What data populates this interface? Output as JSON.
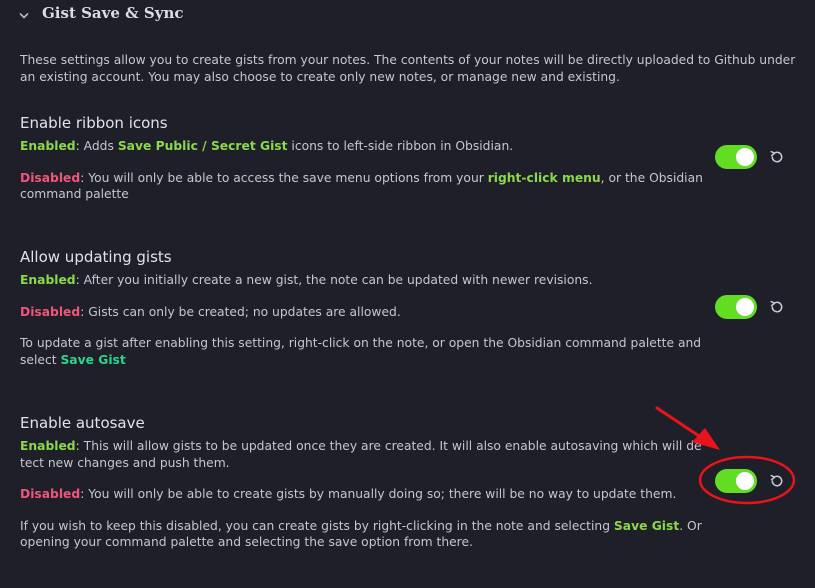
{
  "section": {
    "title": "Gist Save & Sync",
    "intro": "These settings allow you to create gists from your notes. The contents of your notes will be directly uploaded to Github under an existing account. You may also choose to create only new notes, or manage new and existing."
  },
  "settings": [
    {
      "name": "Enable ribbon icons",
      "enabled_label": "Enabled",
      "enabled_a": ": Adds ",
      "enabled_hl": "Save Public / Secret Gist",
      "enabled_b": " icons to left-side ribbon in Obsidian.",
      "disabled_label": "Disabled",
      "disabled_a": ": You will only be able to access the save menu options from your ",
      "disabled_hl": "right-click menu",
      "disabled_b": ", or the Obsidian command palette",
      "toggle_on": true
    },
    {
      "name": "Allow updating gists",
      "enabled_label": "Enabled",
      "enabled_text": ": After you initially create a new gist, the note can be updated with newer revisions.",
      "disabled_label": "Disabled",
      "disabled_text": ": Gists can only be created; no updates are allowed.",
      "extra_a": "To update a gist after enabling this setting, right-click on the note, or open the Obsidian command palette and select ",
      "extra_hl": "Save Gist",
      "toggle_on": true
    },
    {
      "name": "Enable autosave",
      "enabled_label": "Enabled",
      "enabled_text": ": This will allow gists to be updated once they are created. It will also enable autosaving which will detect new changes and push them.",
      "disabled_label": "Disabled",
      "disabled_text": ": You will only be able to create gists by manually doing so; there will be no way to update them.",
      "extra_a": "If you wish to keep this disabled, you can create gists by right-clicking in the note and selecting ",
      "extra_hl": "Save Gist",
      "extra_b": ". Or opening your command palette and selecting the save option from there.",
      "toggle_on": true
    }
  ],
  "icons": {
    "collapse": "chevron-down-icon",
    "reset": "reset-icon"
  },
  "colors": {
    "background": "#1e1f29",
    "enabled": "#8bd94a",
    "disabled": "#f0557a",
    "toggle_on": "#63dc24",
    "annotation": "#e8141b"
  }
}
